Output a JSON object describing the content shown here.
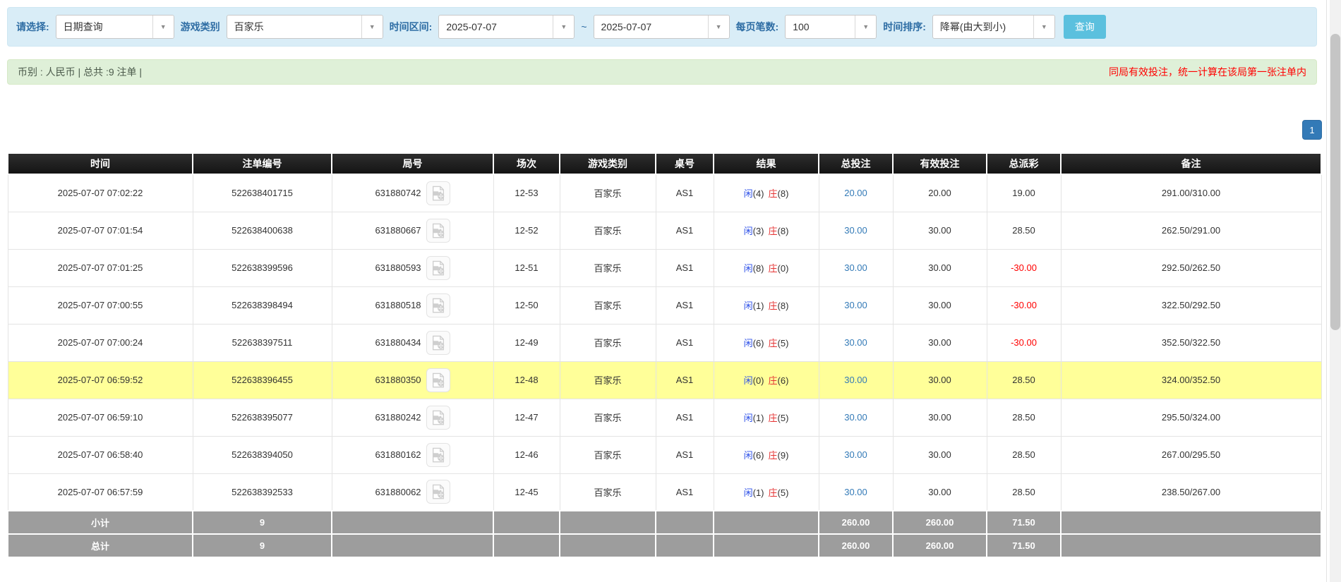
{
  "filters": {
    "select_label": "请选择:",
    "select_value": "日期查询",
    "game_type_label": "游戏类别",
    "game_type_value": "百家乐",
    "time_range_label": "时间区间:",
    "time_from": "2025-07-07",
    "tilde": "~",
    "time_to": "2025-07-07",
    "page_size_label": "每页笔数:",
    "page_size_value": "100",
    "sort_label": "时间排序:",
    "sort_value": "降幂(由大到小)",
    "search_button": "查询"
  },
  "summary_bar": {
    "left_text": "币别 : 人民币 | 总共 :9 注单 |",
    "right_text": "同局有效投注，统一计算在该局第一张注单内"
  },
  "pagination": {
    "current_page": "1"
  },
  "table": {
    "headers": [
      "时间",
      "注单编号",
      "局号",
      "场次",
      "游戏类别",
      "桌号",
      "结果",
      "总投注",
      "有效投注",
      "总派彩",
      "备注"
    ],
    "rows": [
      {
        "time": "2025-07-07 07:02:22",
        "bet_id": "522638401715",
        "round_id": "631880742",
        "session": "12-53",
        "game": "百家乐",
        "table_no": "AS1",
        "result": {
          "player": "闲",
          "player_score": "(4)",
          "banker": "庄",
          "banker_score": "(8)"
        },
        "total_bet": "20.00",
        "valid_bet": "20.00",
        "payout": "19.00",
        "remark": "291.00/310.00",
        "highlight": false
      },
      {
        "time": "2025-07-07 07:01:54",
        "bet_id": "522638400638",
        "round_id": "631880667",
        "session": "12-52",
        "game": "百家乐",
        "table_no": "AS1",
        "result": {
          "player": "闲",
          "player_score": "(3)",
          "banker": "庄",
          "banker_score": "(8)"
        },
        "total_bet": "30.00",
        "valid_bet": "30.00",
        "payout": "28.50",
        "remark": "262.50/291.00",
        "highlight": false
      },
      {
        "time": "2025-07-07 07:01:25",
        "bet_id": "522638399596",
        "round_id": "631880593",
        "session": "12-51",
        "game": "百家乐",
        "table_no": "AS1",
        "result": {
          "player": "闲",
          "player_score": "(8)",
          "banker": "庄",
          "banker_score": "(0)"
        },
        "total_bet": "30.00",
        "valid_bet": "30.00",
        "payout": "-30.00",
        "remark": "292.50/262.50",
        "highlight": false
      },
      {
        "time": "2025-07-07 07:00:55",
        "bet_id": "522638398494",
        "round_id": "631880518",
        "session": "12-50",
        "game": "百家乐",
        "table_no": "AS1",
        "result": {
          "player": "闲",
          "player_score": "(1)",
          "banker": "庄",
          "banker_score": "(8)"
        },
        "total_bet": "30.00",
        "valid_bet": "30.00",
        "payout": "-30.00",
        "remark": "322.50/292.50",
        "highlight": false
      },
      {
        "time": "2025-07-07 07:00:24",
        "bet_id": "522638397511",
        "round_id": "631880434",
        "session": "12-49",
        "game": "百家乐",
        "table_no": "AS1",
        "result": {
          "player": "闲",
          "player_score": "(6)",
          "banker": "庄",
          "banker_score": "(5)"
        },
        "total_bet": "30.00",
        "valid_bet": "30.00",
        "payout": "-30.00",
        "remark": "352.50/322.50",
        "highlight": false
      },
      {
        "time": "2025-07-07 06:59:52",
        "bet_id": "522638396455",
        "round_id": "631880350",
        "session": "12-48",
        "game": "百家乐",
        "table_no": "AS1",
        "result": {
          "player": "闲",
          "player_score": "(0)",
          "banker": "庄",
          "banker_score": "(6)"
        },
        "total_bet": "30.00",
        "valid_bet": "30.00",
        "payout": "28.50",
        "remark": "324.00/352.50",
        "highlight": true
      },
      {
        "time": "2025-07-07 06:59:10",
        "bet_id": "522638395077",
        "round_id": "631880242",
        "session": "12-47",
        "game": "百家乐",
        "table_no": "AS1",
        "result": {
          "player": "闲",
          "player_score": "(1)",
          "banker": "庄",
          "banker_score": "(5)"
        },
        "total_bet": "30.00",
        "valid_bet": "30.00",
        "payout": "28.50",
        "remark": "295.50/324.00",
        "highlight": false
      },
      {
        "time": "2025-07-07 06:58:40",
        "bet_id": "522638394050",
        "round_id": "631880162",
        "session": "12-46",
        "game": "百家乐",
        "table_no": "AS1",
        "result": {
          "player": "闲",
          "player_score": "(6)",
          "banker": "庄",
          "banker_score": "(9)"
        },
        "total_bet": "30.00",
        "valid_bet": "30.00",
        "payout": "28.50",
        "remark": "267.00/295.50",
        "highlight": false
      },
      {
        "time": "2025-07-07 06:57:59",
        "bet_id": "522638392533",
        "round_id": "631880062",
        "session": "12-45",
        "game": "百家乐",
        "table_no": "AS1",
        "result": {
          "player": "闲",
          "player_score": "(1)",
          "banker": "庄",
          "banker_score": "(5)"
        },
        "total_bet": "30.00",
        "valid_bet": "30.00",
        "payout": "28.50",
        "remark": "238.50/267.00",
        "highlight": false
      }
    ],
    "subtotal": {
      "label": "小计",
      "count": "9",
      "total_bet": "260.00",
      "valid_bet": "260.00",
      "payout": "71.50"
    },
    "total": {
      "label": "总计",
      "count": "9",
      "total_bet": "260.00",
      "valid_bet": "260.00",
      "payout": "71.50"
    }
  },
  "colors": {
    "accent_button": "#5bc0de",
    "pagination_blue": "#337ab7",
    "link_blue": "#337ab7",
    "player_blue": "#2d50e8",
    "banker_red": "#e53333",
    "negative_red": "#ff0000",
    "highlight_yellow": "#ffff99",
    "filter_bar_bg": "#d9edf7",
    "info_bar_bg": "#dff0d8",
    "header_bg": "#1c1c1c",
    "summary_bg": "#9d9d9d"
  }
}
